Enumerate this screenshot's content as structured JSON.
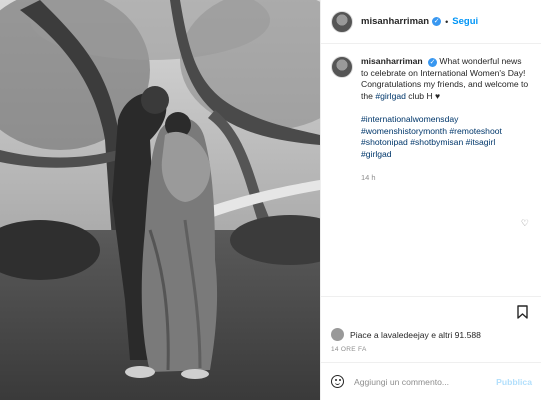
{
  "post": {
    "username": "misanharriman",
    "separator": "•",
    "follow_label": "Segui",
    "caption": {
      "username": "misanharriman",
      "text_before": "What wonderful news to celebrate on International Women's Day! Congratulations my friends, and welcome to the ",
      "hashtag_inline": "#girlgad",
      "text_after": " club H ♥",
      "hashtags_line1": "#internationalwomensday",
      "hashtags_line2": "#womenshistorymonth #remoteshoot",
      "hashtags_line3": "#shotonipad #shotbymisan #itsagirl",
      "hashtags_line4": "#girlgad",
      "time": "14 h"
    },
    "likes_text": "Piace a lavaledeejay e altri 91.588",
    "date": "14 ORE FA",
    "comment_placeholder": "Aggiungi un commento...",
    "publish_label": "Pubblica"
  },
  "colors": {
    "accent": "#0095f6",
    "verified": "#3897f0"
  },
  "icons": {
    "verified": "verified-badge-icon",
    "heart": "heart-icon",
    "bookmark": "bookmark-icon",
    "emoji": "emoji-icon"
  }
}
